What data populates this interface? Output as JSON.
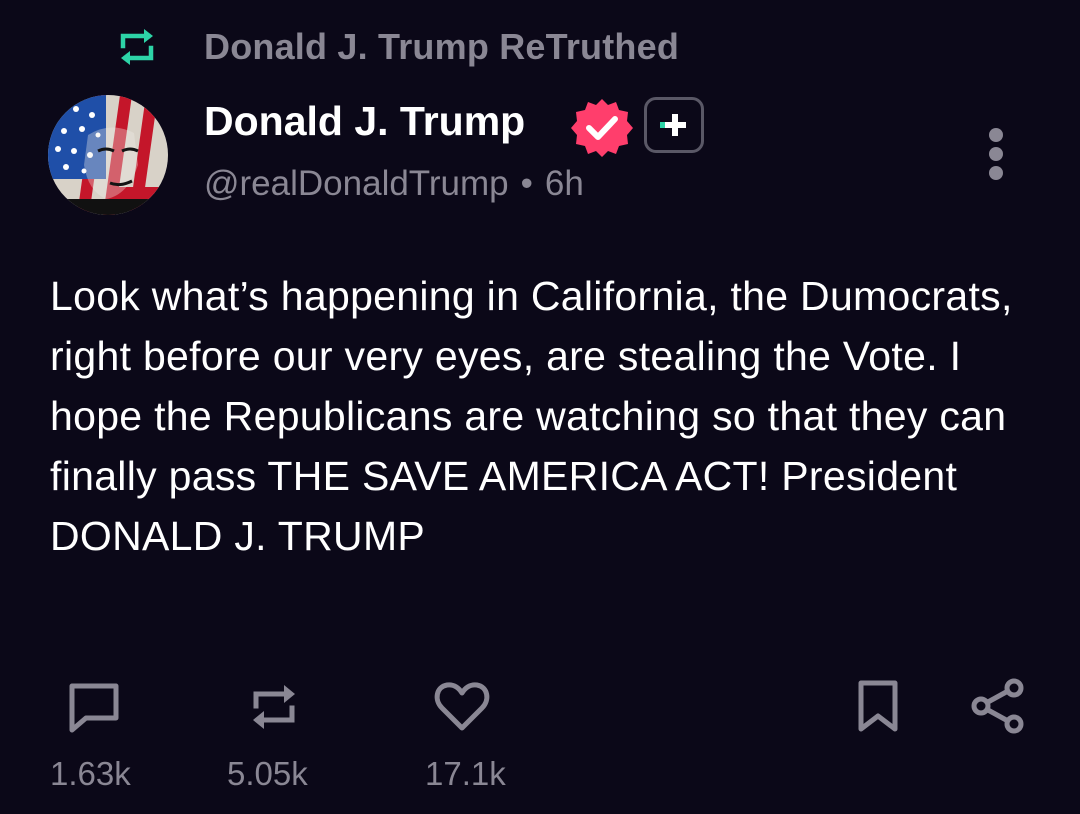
{
  "retruth": {
    "label": "Donald J. Trump ReTruthed",
    "icon": "retruth-icon",
    "color": "#2dd4a7"
  },
  "author": {
    "name": "Donald J. Trump",
    "handle": "@realDonaldTrump",
    "separator": "•",
    "time": "6h",
    "verified_icon": "verified-badge-icon",
    "verified_color": "#ff3e6c",
    "plus_icon": "truth-plus-icon"
  },
  "post": {
    "text": "Look what’s happening in California, the Dumocrats, right before our very eyes, are stealing the Vote. I hope the Republicans are watching so that they can finally pass THE SAVE AMERICA ACT! President DONALD J. TRUMP"
  },
  "actions": {
    "reply": {
      "icon": "reply-icon",
      "count": "1.63k"
    },
    "retruth": {
      "icon": "retruth-icon",
      "count": "5.05k"
    },
    "like": {
      "icon": "heart-icon",
      "count": "17.1k"
    },
    "bookmark": {
      "icon": "bookmark-icon"
    },
    "share": {
      "icon": "share-icon"
    }
  },
  "colors": {
    "background": "#0b0818",
    "muted": "#8a8794",
    "accent_green": "#2dd4a7"
  }
}
